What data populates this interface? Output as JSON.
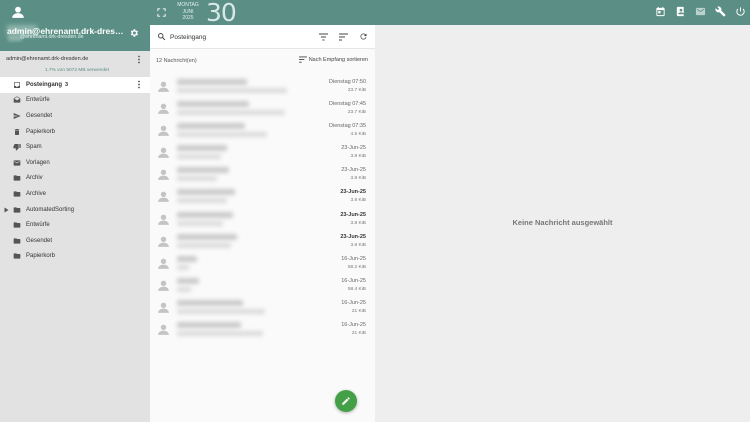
{
  "account": {
    "name": "admin@ehrenamt.drk-dresden.de",
    "email": "@ehrenamt.drk-dresden.de",
    "address": "admin@ehrenamt.drk-dresden.de",
    "quota": "1.7% von 5072 MB verwendet"
  },
  "calendar": {
    "weekday": "MONTAG",
    "month": "JUNI",
    "year": "2025",
    "day": "30"
  },
  "folders": [
    {
      "label": "Posteingang",
      "count": "3",
      "icon": "inbox-icon",
      "active": true
    },
    {
      "label": "Entwürfe",
      "icon": "drafts-icon"
    },
    {
      "label": "Gesendet",
      "icon": "send-icon"
    },
    {
      "label": "Papierkorb",
      "icon": "trash-icon"
    },
    {
      "label": "Spam",
      "icon": "spam-icon"
    },
    {
      "label": "Vorlagen",
      "icon": "template-icon"
    },
    {
      "label": "Archiv",
      "icon": "folder-icon"
    },
    {
      "label": "Archive",
      "icon": "folder-icon"
    },
    {
      "label": "AutomatedSorting",
      "icon": "folder-icon",
      "expandable": true
    },
    {
      "label": "Entwürfe",
      "icon": "folder-icon"
    },
    {
      "label": "Gesendet",
      "icon": "folder-icon"
    },
    {
      "label": "Papierkorb",
      "icon": "folder-icon"
    }
  ],
  "search": {
    "value": "Posteingang",
    "placeholder": "Posteingang"
  },
  "list": {
    "count_label": "12 Nachricht(en)",
    "sort_label": "Nach Empfang sortieren"
  },
  "messages": [
    {
      "date": "Dienstag 07:50",
      "size": "23.7 KiB",
      "unread": false
    },
    {
      "date": "Dienstag 07:45",
      "size": "23.7 KiB",
      "unread": false
    },
    {
      "date": "Dienstag 07:35",
      "size": "4.5 KiB",
      "unread": false
    },
    {
      "date": "23-Jun-25",
      "size": "3.8 KiB",
      "unread": false
    },
    {
      "date": "23-Jun-25",
      "size": "3.8 KiB",
      "unread": false
    },
    {
      "date": "23-Jun-25",
      "size": "3.8 KiB",
      "unread": true
    },
    {
      "date": "23-Jun-25",
      "size": "3.8 KiB",
      "unread": true
    },
    {
      "date": "23-Jun-25",
      "size": "3.8 KiB",
      "unread": true
    },
    {
      "date": "16-Jun-25",
      "size": "58.2 KiB",
      "unread": false
    },
    {
      "date": "16-Jun-25",
      "size": "58.4 KiB",
      "unread": false
    },
    {
      "date": "16-Jun-25",
      "size": "21 KiB",
      "unread": false
    },
    {
      "date": "16-Jun-25",
      "size": "21 KiB",
      "unread": false
    }
  ],
  "reading_pane": {
    "empty_text": "Keine Nachricht ausgewählt"
  },
  "colors": {
    "primary": "#5b8f85",
    "compose": "#43a047"
  }
}
